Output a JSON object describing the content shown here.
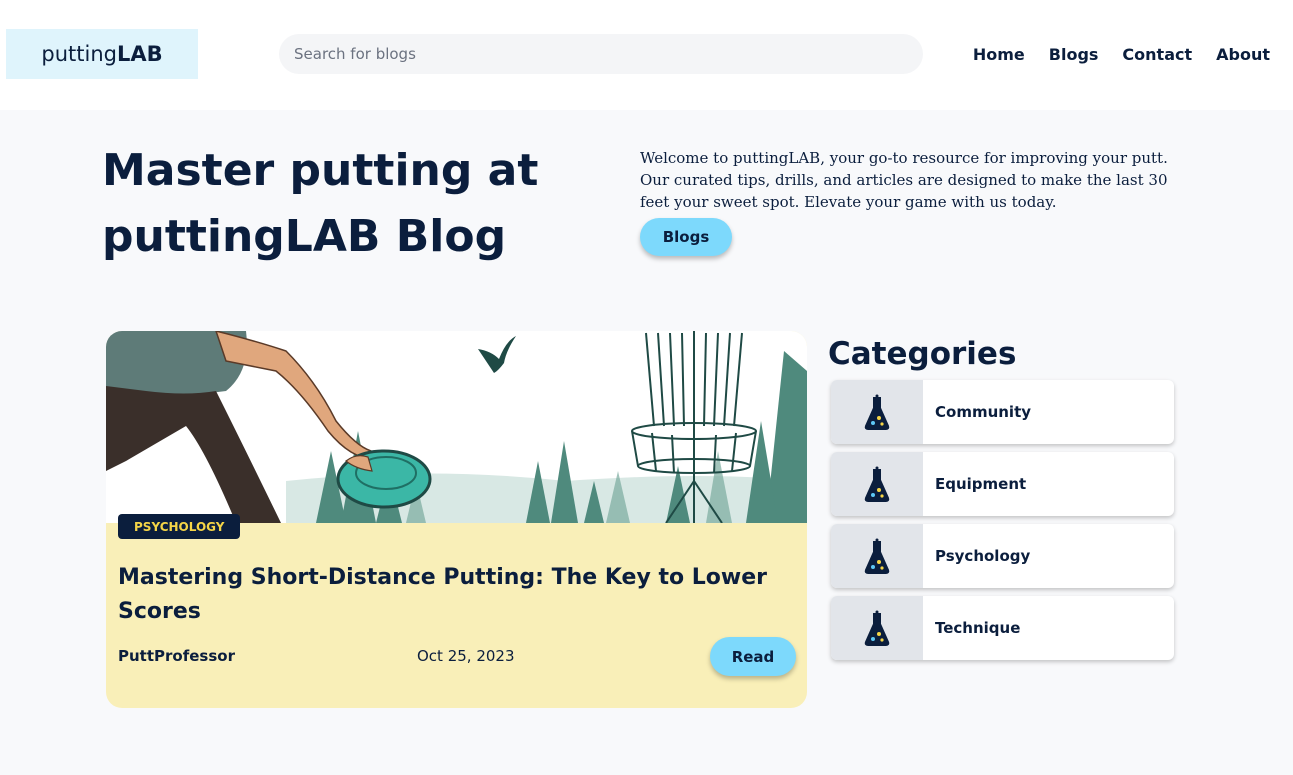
{
  "header": {
    "logo_light": "putting",
    "logo_bold": "LAB",
    "search_placeholder": "Search for blogs",
    "nav": [
      "Home",
      "Blogs",
      "Contact",
      "About"
    ]
  },
  "hero": {
    "title": "Master putting at puttingLAB Blog",
    "description": "Welcome to puttingLAB, your go-to resource for improving your putt. Our curated tips, drills, and articles are designed to make the last 30 feet your sweet spot. Elevate your game with us today.",
    "button_label": "Blogs"
  },
  "post": {
    "tag": "PSYCHOLOGY",
    "title": "Mastering Short-Distance Putting: The Key to Lower Scores",
    "author": "PuttProfessor",
    "date": "Oct 25, 2023",
    "read_label": "Read"
  },
  "categories": {
    "heading": "Categories",
    "items": [
      {
        "label": "Community",
        "icon": "flask-icon"
      },
      {
        "label": "Equipment",
        "icon": "flask-icon"
      },
      {
        "label": "Psychology",
        "icon": "flask-icon"
      },
      {
        "label": "Technique",
        "icon": "flask-icon"
      }
    ]
  },
  "colors": {
    "navy": "#0b1e3d",
    "accent_blue": "#7dd9fc",
    "card_yellow": "#f9efb8",
    "tag_text": "#f5d547",
    "logo_bg": "#dff4fc"
  }
}
